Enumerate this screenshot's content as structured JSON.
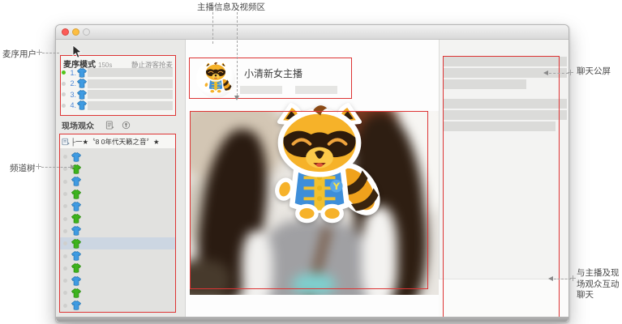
{
  "annotations": {
    "video_area_label": "主播信息及视频区",
    "mic_users_label": "麦序用户",
    "channel_tree_label": "频道树",
    "chat_screen_label": "聊天公屏",
    "interact_chat_lines": [
      "与主播及现",
      "场观众互动",
      "聊天"
    ]
  },
  "window": {
    "mic_panel": {
      "title": "麦序模式",
      "timer": "150s",
      "note": "静止游客抢麦",
      "queue_numbers": [
        "1.",
        "2.",
        "3.",
        "4."
      ],
      "online_index": 0
    },
    "audience_label": "现场观众",
    "channel_tree": {
      "header": "├一★〝8 0年代天籁之音〞★",
      "shirts": [
        "blue",
        "green",
        "blue",
        "green",
        "blue",
        "green",
        "blue",
        "green",
        "blue",
        "green",
        "blue",
        "green",
        "blue"
      ],
      "selected_index": 7
    },
    "anchor_name": "小清新女主播",
    "chat_bars": [
      {
        "w": 1.0,
        "gap_before": false
      },
      {
        "w": 1.0,
        "gap_before": false
      },
      {
        "w": 0.67,
        "gap_before": false
      },
      {
        "w": 1.0,
        "gap_before": true
      },
      {
        "w": 1.0,
        "gap_before": false
      },
      {
        "w": 0.91,
        "gap_before": false
      }
    ]
  },
  "colors": {
    "annotation_red": "#dd3434",
    "shirt_blue": "#3f9be2",
    "shirt_blue_edge": "#2c79b5",
    "shirt_green": "#3db31e",
    "shirt_green_edge": "#2f8d13",
    "online_green": "#52c41a"
  }
}
